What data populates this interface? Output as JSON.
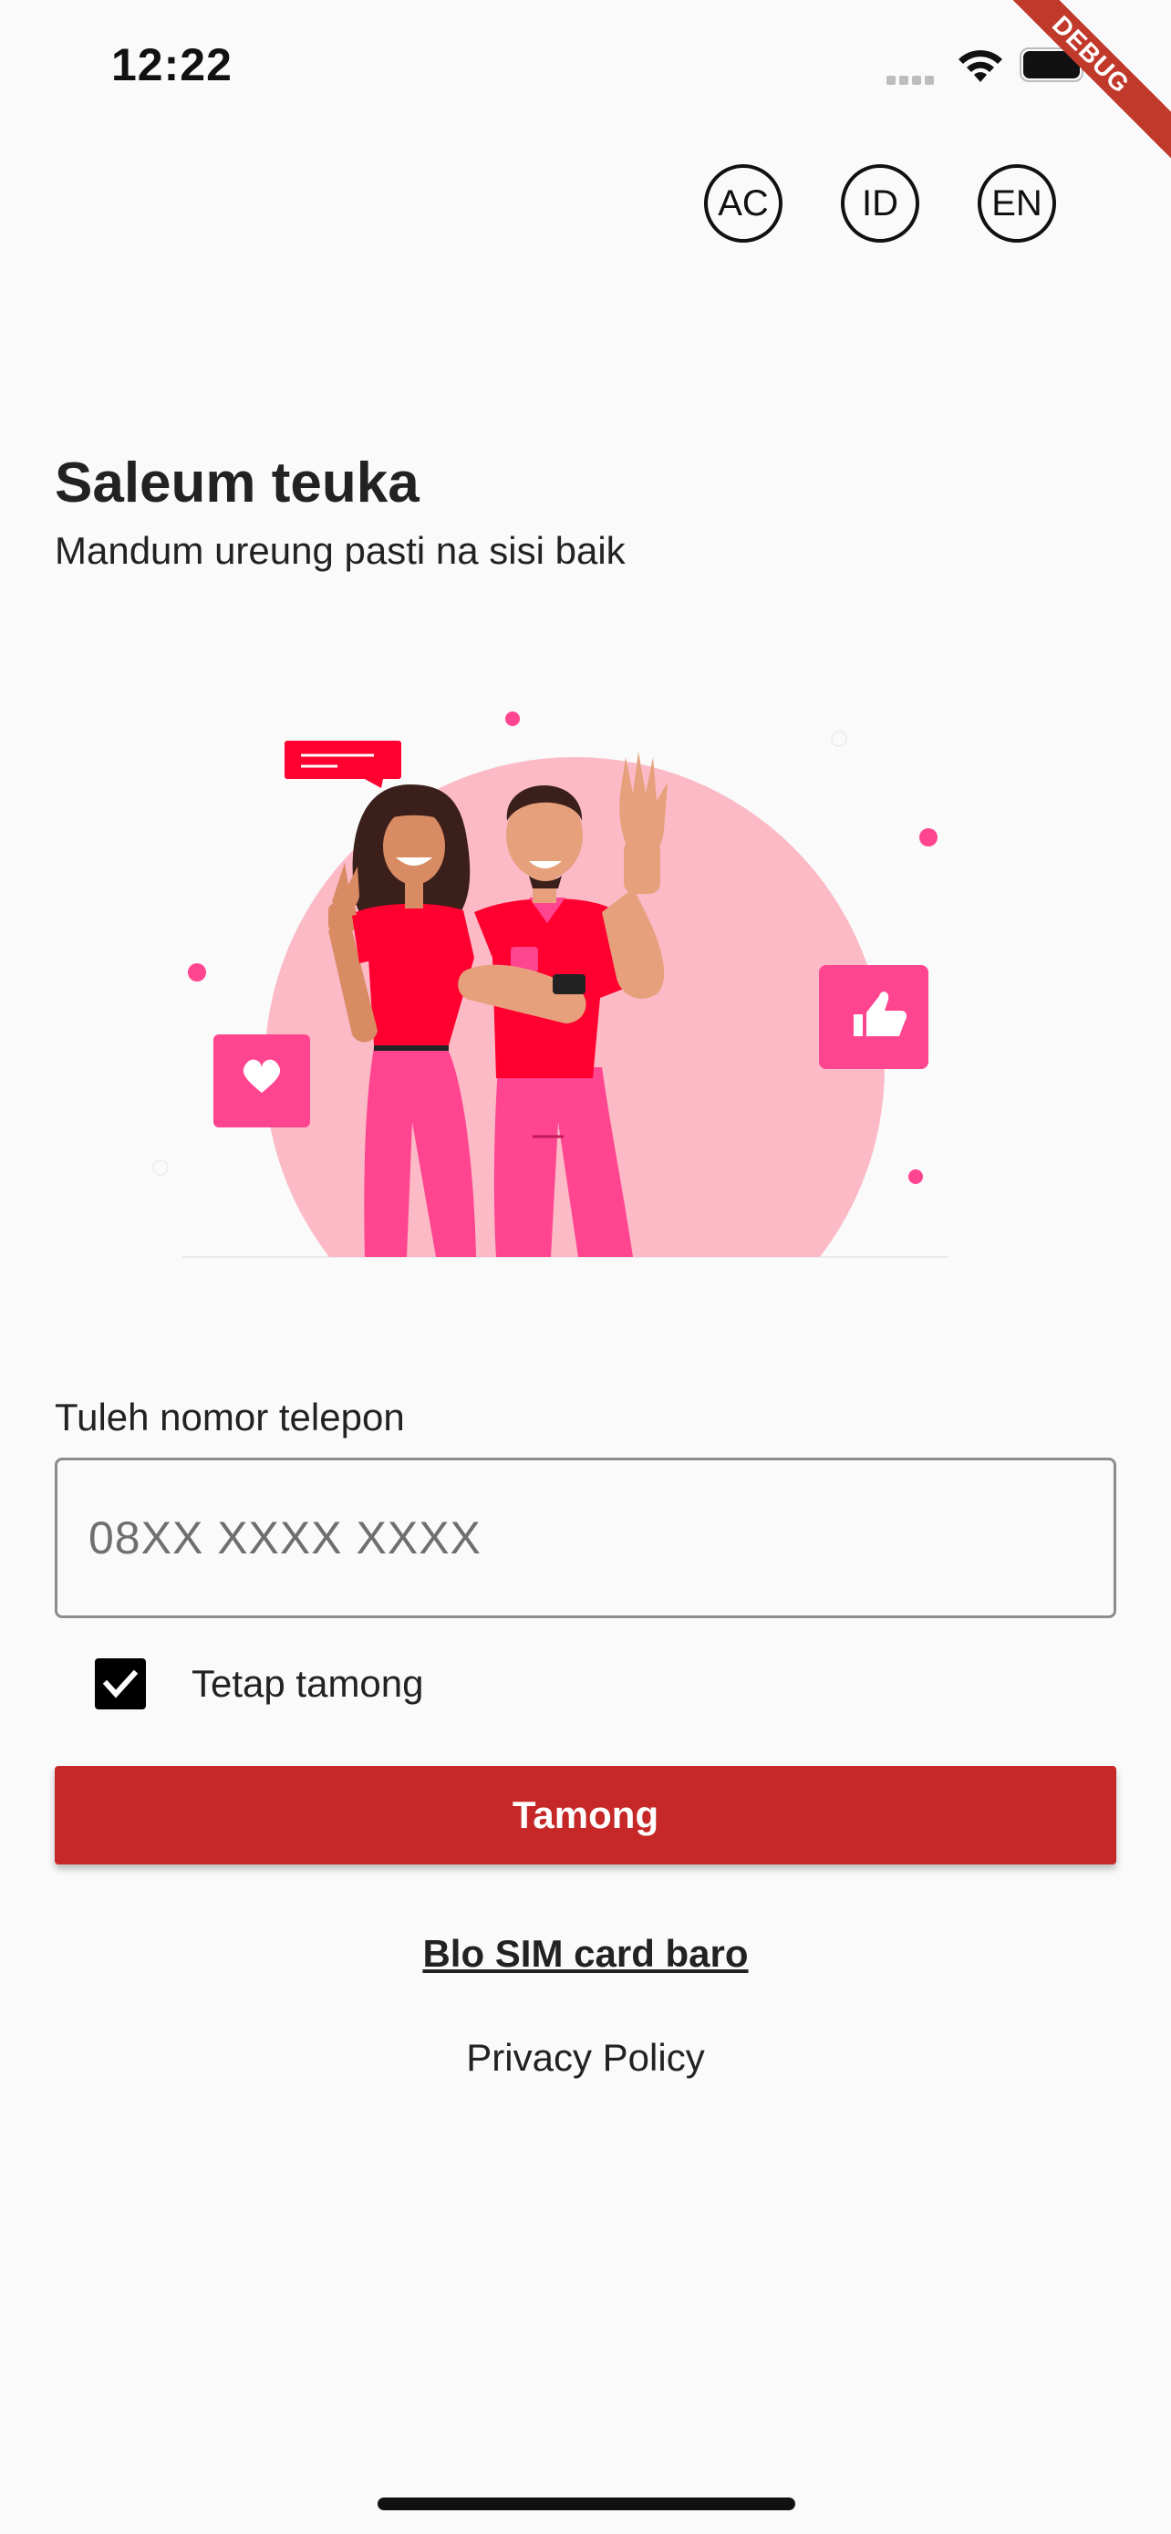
{
  "status_bar": {
    "time": "12:22",
    "debug_label": "DEBUG"
  },
  "language_switcher": [
    {
      "code": "AC"
    },
    {
      "code": "ID"
    },
    {
      "code": "EN"
    }
  ],
  "greeting": {
    "title": "Saleum teuka",
    "subtitle": "Mandum ureung pasti na sisi baik"
  },
  "illustration": {
    "icon": "people-greeting-illustration",
    "colors": {
      "circle": "#fbbac6",
      "primary_red": "#ff0030",
      "pink": "#ff4490",
      "skin": "#e6a07c"
    }
  },
  "form": {
    "phone_label": "Tuleh nomor telepon",
    "phone_placeholder": "08XX XXXX XXXX",
    "phone_value": "",
    "remember_label": "Tetap tamong",
    "remember_checked": true,
    "login_button": "Tamong"
  },
  "links": {
    "new_sim": "Blo SIM card baro",
    "privacy": "Privacy Policy"
  },
  "colors": {
    "accent": "#c62828",
    "background": "#fafafa"
  }
}
